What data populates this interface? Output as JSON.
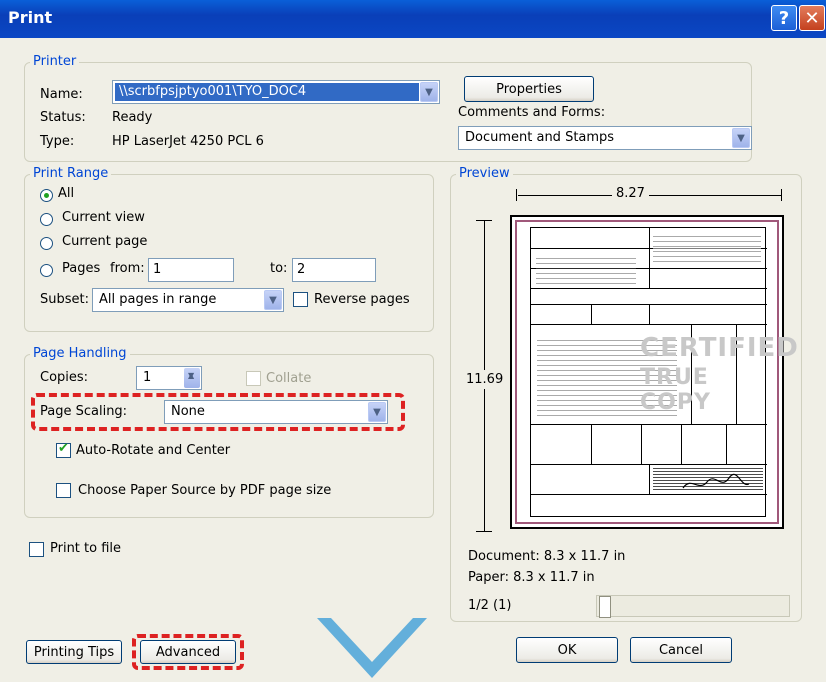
{
  "window": {
    "title": "Print"
  },
  "printer": {
    "group_label": "Printer",
    "name_label": "Name:",
    "name_value": "\\\\scrbfpsjptyo001\\TYO_DOC4",
    "status_label": "Status:",
    "status_value": "Ready",
    "type_label": "Type:",
    "type_value": "HP LaserJet 4250 PCL 6",
    "properties_label": "Properties",
    "comments_label": "Comments and Forms:",
    "comments_value": "Document and Stamps"
  },
  "print_range": {
    "group_label": "Print Range",
    "all": "All",
    "current_view": "Current view",
    "current_page": "Current page",
    "pages": "Pages",
    "from_label": "from:",
    "from_value": "1",
    "to_label": "to:",
    "to_value": "2",
    "subset_label": "Subset:",
    "subset_value": "All pages in range",
    "reverse_label": "Reverse pages"
  },
  "page_handling": {
    "group_label": "Page Handling",
    "copies_label": "Copies:",
    "copies_value": "1",
    "collate_label": "Collate",
    "scaling_label": "Page Scaling:",
    "scaling_value": "None",
    "auto_rotate_label": "Auto-Rotate and Center",
    "paper_source_label": "Choose Paper Source by PDF page size"
  },
  "print_to_file_label": "Print to file",
  "preview": {
    "group_label": "Preview",
    "width": "8.27",
    "height": "11.69",
    "stamp_line1": "CERTIFIED",
    "stamp_line2": "TRUE COPY",
    "document_size": "Document: 8.3 x 11.7 in",
    "paper_size": "Paper: 8.3 x 11.7 in",
    "page_indicator": "1/2 (1)"
  },
  "buttons": {
    "printing_tips": "Printing Tips",
    "advanced": "Advanced",
    "ok": "OK",
    "cancel": "Cancel"
  },
  "colors": {
    "title_bar": "#0a3fb8",
    "group_label": "#0046d5",
    "highlight": "#d22222"
  }
}
